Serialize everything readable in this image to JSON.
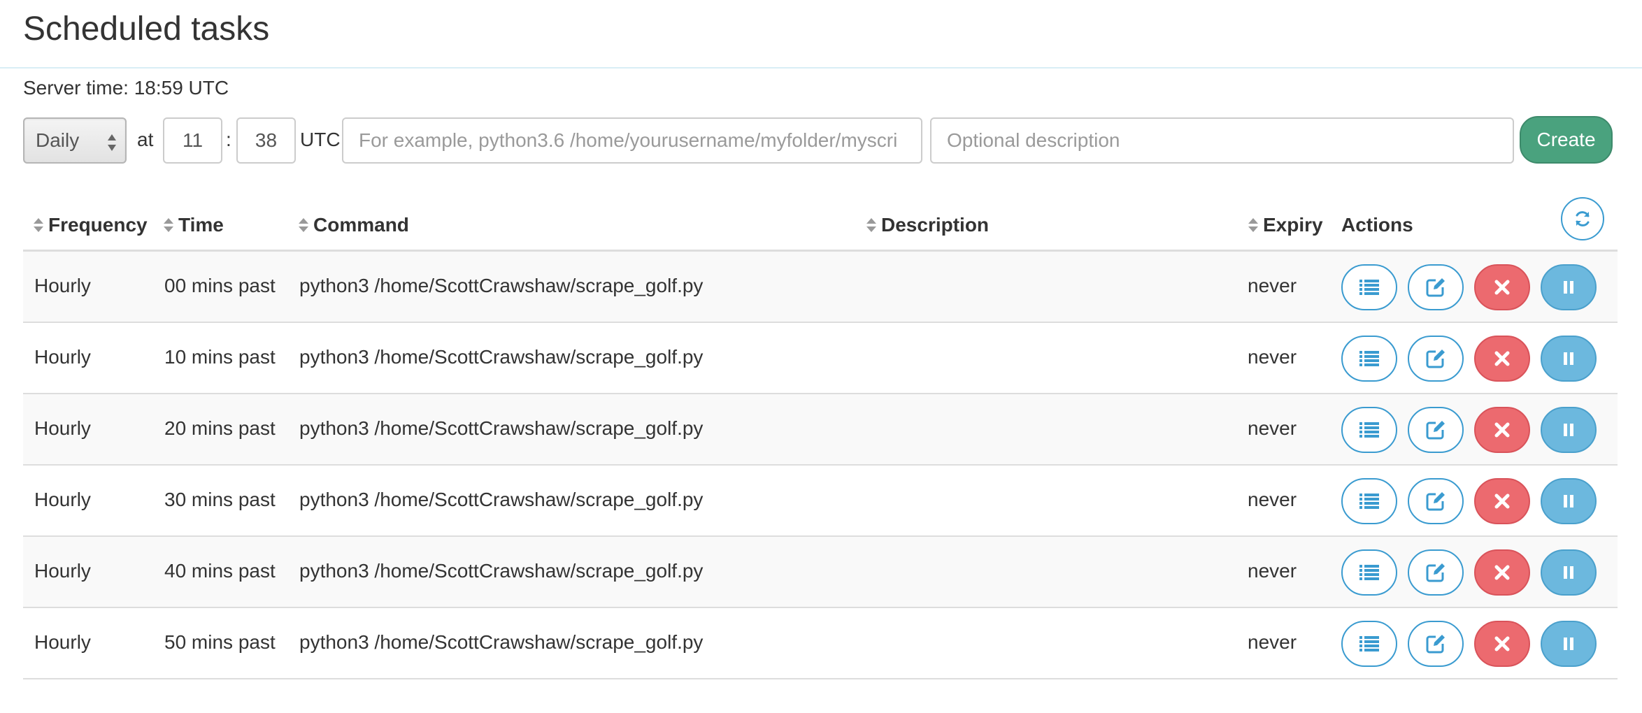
{
  "page": {
    "title": "Scheduled tasks",
    "server_time": "Server time: 18:59 UTC"
  },
  "form": {
    "frequency_value": "Daily",
    "at_label": "at",
    "hour_value": "11",
    "colon": ":",
    "minute_value": "38",
    "utc_label": "UTC",
    "command_placeholder": "For example, python3.6 /home/yourusername/myfolder/myscri",
    "description_placeholder": "Optional description",
    "create_label": "Create"
  },
  "table": {
    "headers": {
      "frequency": "Frequency",
      "time": "Time",
      "command": "Command",
      "description": "Description",
      "expiry": "Expiry",
      "actions": "Actions"
    },
    "rows": [
      {
        "frequency": "Hourly",
        "time": "00 mins past",
        "command": "python3 /home/ScottCrawshaw/scrape_golf.py",
        "description": "",
        "expiry": "never"
      },
      {
        "frequency": "Hourly",
        "time": "10 mins past",
        "command": "python3 /home/ScottCrawshaw/scrape_golf.py",
        "description": "",
        "expiry": "never"
      },
      {
        "frequency": "Hourly",
        "time": "20 mins past",
        "command": "python3 /home/ScottCrawshaw/scrape_golf.py",
        "description": "",
        "expiry": "never"
      },
      {
        "frequency": "Hourly",
        "time": "30 mins past",
        "command": "python3 /home/ScottCrawshaw/scrape_golf.py",
        "description": "",
        "expiry": "never"
      },
      {
        "frequency": "Hourly",
        "time": "40 mins past",
        "command": "python3 /home/ScottCrawshaw/scrape_golf.py",
        "description": "",
        "expiry": "never"
      },
      {
        "frequency": "Hourly",
        "time": "50 mins past",
        "command": "python3 /home/ScottCrawshaw/scrape_golf.py",
        "description": "",
        "expiry": "never"
      }
    ]
  },
  "icons": {
    "sort": "sort-icon",
    "refresh": "refresh-icon",
    "log": "list-icon",
    "edit": "edit-icon",
    "delete": "close-icon",
    "pause": "pause-icon"
  },
  "colors": {
    "create": "#4aa27e",
    "outline_blue": "#3a9bd0",
    "danger": "#ec6a6f",
    "info": "#6cb8de"
  }
}
